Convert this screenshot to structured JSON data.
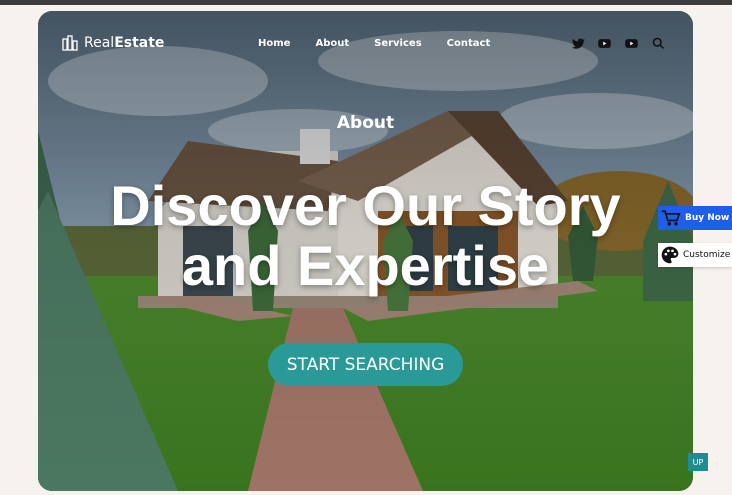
{
  "header": {
    "logo_light": "Real",
    "logo_bold": "Estate",
    "nav": [
      "Home",
      "About",
      "Services",
      "Contact"
    ],
    "icons": [
      "twitter-icon",
      "youtube-icon",
      "youtube-icon",
      "search-icon"
    ]
  },
  "hero": {
    "kicker": "About",
    "headline_line1": "Discover Our Story",
    "headline_line2": "and Expertise",
    "cta_label": "START SEARCHING"
  },
  "side": {
    "buy_now": "Buy Now",
    "customize": "Customize"
  },
  "up_label": "UP",
  "colors": {
    "accent": "#2a9a98",
    "buy_now": "#1f5ee8",
    "page_bg": "#f6f3ef"
  }
}
